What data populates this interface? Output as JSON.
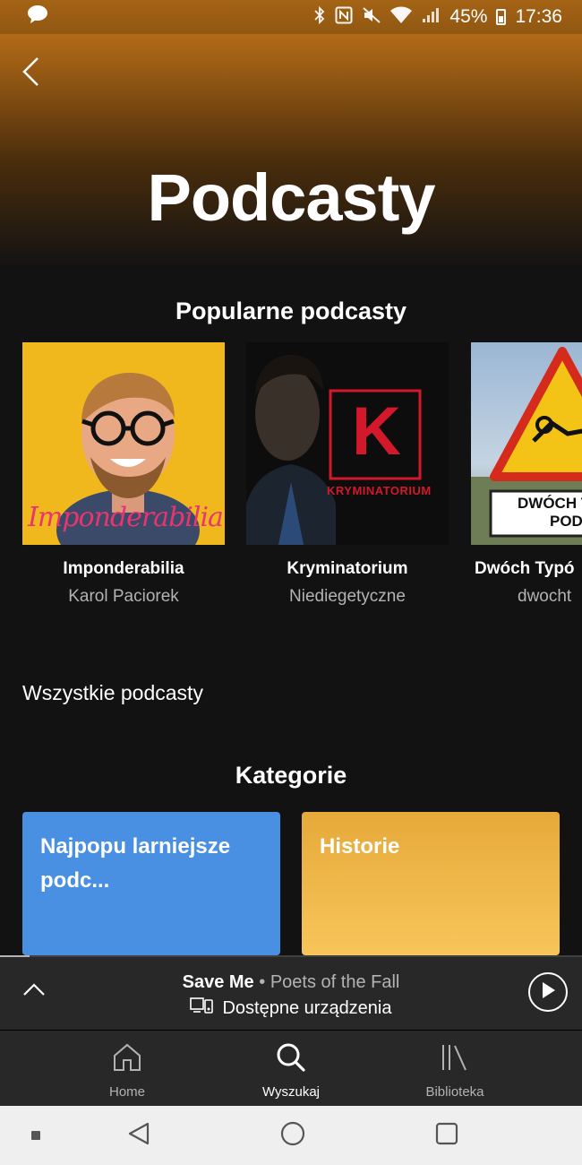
{
  "status_bar": {
    "battery": "45%",
    "time": "17:36"
  },
  "header": {
    "title": "Podcasty"
  },
  "popular": {
    "section_title": "Popularne podcasty",
    "items": [
      {
        "name": "Imponderabilia",
        "author": "Karol Paciorek",
        "cover_text": "Imponderabilia"
      },
      {
        "name": "Kryminatorium",
        "author": "Niediegetyczne",
        "cover_letter": "K",
        "cover_text": "KRYMINATORIUM"
      },
      {
        "name": "Dwóch Typó",
        "author": "dwocht",
        "cover_text_1": "DWÓCH T",
        "cover_text_2": "PODCA"
      }
    ]
  },
  "all_podcasts_label": "Wszystkie podcasty",
  "categories": {
    "section_title": "Kategorie",
    "items": [
      {
        "label": "Najpopu larniejsze podc...",
        "color": "#4a90e2"
      },
      {
        "label": "Historie",
        "color": "#f2b94e"
      }
    ]
  },
  "now_playing": {
    "title": "Save Me",
    "separator": "•",
    "artist": "Poets of the Fall",
    "device_text": "Dostępne urządzenia",
    "progress": 0.05
  },
  "bottom_nav": {
    "items": [
      {
        "label": "Home",
        "icon": "home-icon",
        "active": false
      },
      {
        "label": "Wyszukaj",
        "icon": "search-icon",
        "active": true
      },
      {
        "label": "Biblioteka",
        "icon": "library-icon",
        "active": false
      }
    ]
  },
  "colors": {
    "background": "#121212",
    "header_gradient": "#c97a1a",
    "player_bar": "#282828",
    "secondary_text": "#b3b3b3"
  }
}
